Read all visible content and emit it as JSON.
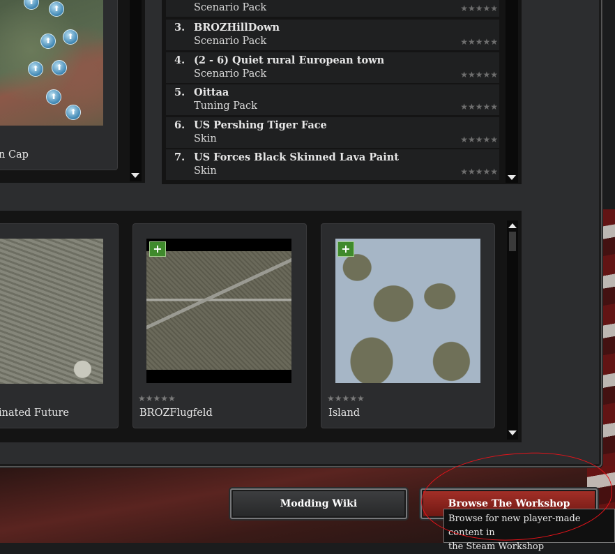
{
  "top_left_card": {
    "caption": "n Cap"
  },
  "content_list": {
    "rows": [
      {
        "num": "",
        "title": "",
        "type": "Scenario Pack",
        "stars": "★★★★★"
      },
      {
        "num": "3.",
        "title": "BROZHillDown",
        "type": "Scenario Pack",
        "stars": "★★★★★"
      },
      {
        "num": "4.",
        "title": "(2 - 6) Quiet rural European town",
        "type": "Scenario Pack",
        "stars": "★★★★★"
      },
      {
        "num": "5.",
        "title": "Oittaa",
        "type": "Tuning Pack",
        "stars": "★★★★★"
      },
      {
        "num": "6.",
        "title": "US Pershing Tiger Face",
        "type": "Skin",
        "stars": "★★★★★"
      },
      {
        "num": "7.",
        "title": "US Forces Black Skinned Lava Paint",
        "type": "Skin",
        "stars": "★★★★★"
      }
    ]
  },
  "cards": [
    {
      "title": "inated Future",
      "stars": ""
    },
    {
      "title": "BROZFlugfeld",
      "stars": "★★★★★",
      "badge": "+"
    },
    {
      "title": "Island",
      "stars": "★★★★★",
      "badge": "+"
    }
  ],
  "buttons": {
    "modding_wiki": "Modding Wiki",
    "browse_workshop": "Browse The Workshop"
  },
  "tooltip": {
    "line1": "Browse for new player-made content in",
    "line2": "the Steam Workshop"
  },
  "colors": {
    "accent_red": "#a53028",
    "annotation": "#e8131a",
    "plus_green": "#3f8a2c"
  }
}
